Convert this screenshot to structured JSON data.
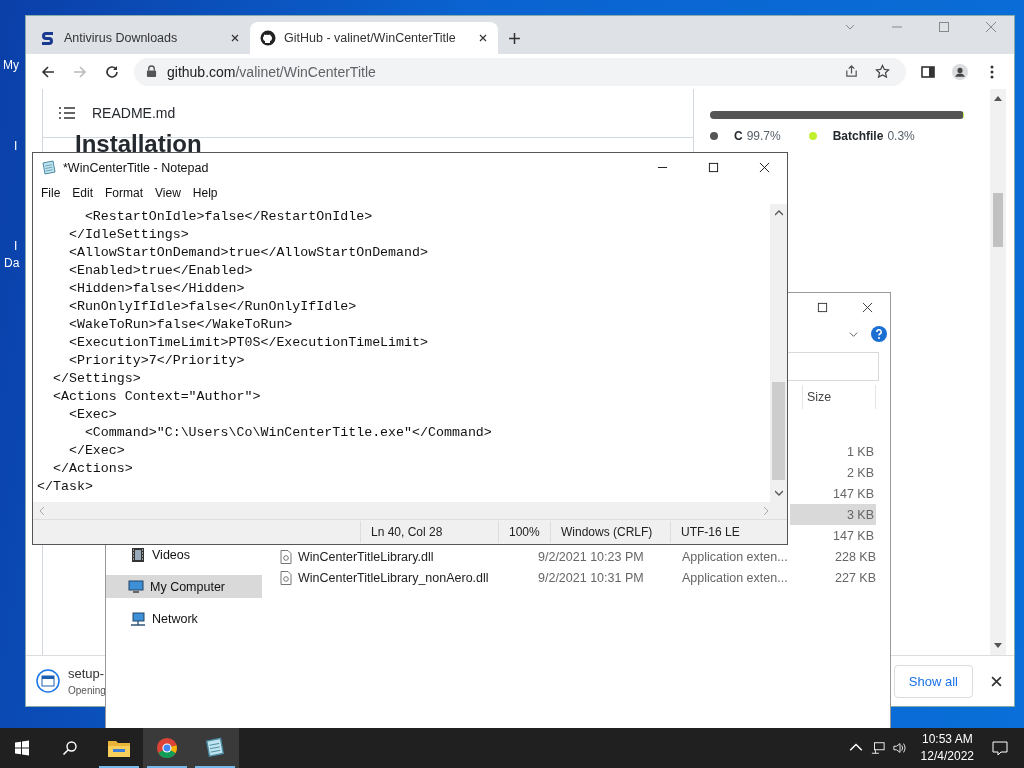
{
  "desktop": {
    "labels": [
      "My",
      "I",
      "I",
      "Da"
    ]
  },
  "browser": {
    "tabs": [
      {
        "title": "Antivirus Downloads",
        "selected": false
      },
      {
        "title": "GitHub - valinet/WinCenterTitle",
        "selected": true
      }
    ],
    "url": {
      "host": "github.com",
      "path": "/valinet/WinCenterTitle"
    },
    "forward_disabled": true,
    "readme": {
      "file": "README.md",
      "heading": "Installation"
    },
    "languages": [
      {
        "name": "C",
        "percent": "99.7%",
        "color": "#555555",
        "level": 0.997
      },
      {
        "name": "Batchfile",
        "percent": "0.3%",
        "color": "#c1f12e",
        "level": 0.003
      }
    ],
    "download": {
      "file": "setup-",
      "status": "Opening",
      "show_all": "Show all"
    }
  },
  "explorer": {
    "size_column": "Size",
    "nav_items": [
      {
        "label": "Videos",
        "selected": false
      },
      {
        "label": "My Computer",
        "selected": true
      },
      {
        "label": "Network",
        "selected": false
      }
    ],
    "rows": [
      {
        "size": "1 KB",
        "selected": false
      },
      {
        "size": "2 KB",
        "selected": false
      },
      {
        "size": "147 KB",
        "selected": false
      },
      {
        "size": "3 KB",
        "selected": true
      },
      {
        "size": "147 KB",
        "selected": false
      },
      {
        "name": "WinCenterTitleLibrary.dll",
        "date": "9/2/2021 10:23 PM",
        "type": "Application exten...",
        "size": "228 KB",
        "selected": false
      },
      {
        "name": "WinCenterTitleLibrary_nonAero.dll",
        "date": "9/2/2021 10:31 PM",
        "type": "Application exten...",
        "size": "227 KB",
        "selected": false
      }
    ]
  },
  "notepad": {
    "title": "*WinCenterTitle - Notepad",
    "menu": [
      "File",
      "Edit",
      "Format",
      "View",
      "Help"
    ],
    "lines": [
      "      <RestartOnIdle>false</RestartOnIdle>",
      "    </IdleSettings>",
      "    <AllowStartOnDemand>true</AllowStartOnDemand>",
      "    <Enabled>true</Enabled>",
      "    <Hidden>false</Hidden>",
      "    <RunOnlyIfIdle>false</RunOnlyIfIdle>",
      "    <WakeToRun>false</WakeToRun>",
      "    <ExecutionTimeLimit>PT0S</ExecutionTimeLimit>",
      "    <Priority>7</Priority>",
      "  </Settings>",
      "  <Actions Context=\"Author\">",
      "    <Exec>",
      "      <Command>\"C:\\Users\\Co\\WinCenterTitle.exe\"</Command>",
      "    </Exec>",
      "  </Actions>",
      "</Task>"
    ],
    "status": [
      "Ln 40, Col 28",
      "100%",
      "Windows (CRLF)",
      "UTF-16 LE"
    ]
  },
  "taskbar": {
    "apps": [
      {
        "active": false
      },
      {
        "active": true
      },
      {
        "active": true
      }
    ],
    "time": "10:53 AM",
    "date": "12/4/2022"
  }
}
